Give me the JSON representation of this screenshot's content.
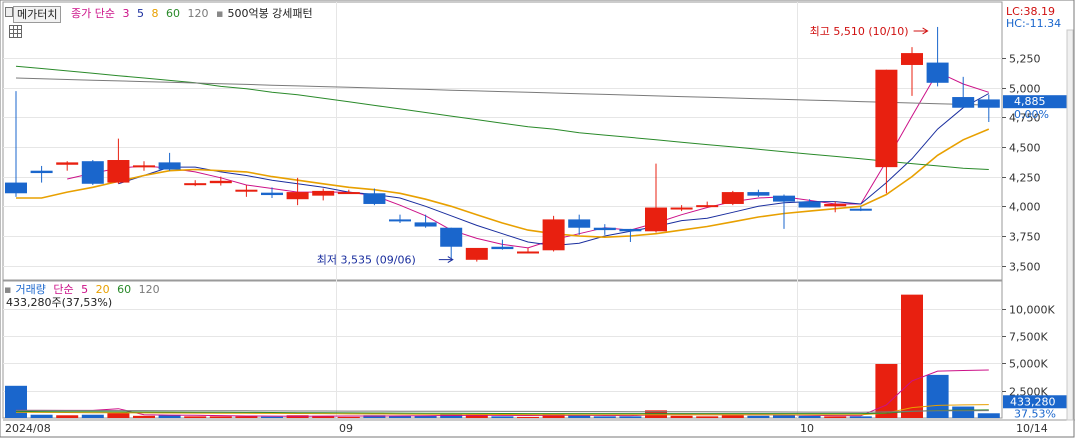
{
  "price_legend": {
    "tab_label": "메가터치",
    "ma_prefix": "종가 단순",
    "ma_periods": [
      "3",
      "5",
      "8",
      "60",
      "120"
    ],
    "ma_colors": [
      "#cc1188",
      "#1a2e9e",
      "#e8a000",
      "#2a8a2a",
      "#7a7a7a"
    ],
    "pattern_label": "500억봉 강세패턴"
  },
  "volume_legend": {
    "label": "거래량",
    "ma_prefix": "단순",
    "ma_periods": [
      "5",
      "20",
      "60",
      "120"
    ],
    "ma_colors": [
      "#cc1188",
      "#e8a000",
      "#2a8a2a",
      "#7a7a7a"
    ],
    "summary": "433,280주(37,53%)"
  },
  "right_panel": {
    "lc": "LC:38.19",
    "hc": "HC:-11.34",
    "current_price": "4,885",
    "current_change": "0.00%",
    "current_volume": "433,280",
    "current_volume_pct": "37.53%"
  },
  "annotations": {
    "high": "최고 5,510 (10/10)",
    "low": "최저 3,535 (09/06)"
  },
  "colors": {
    "up": "#e82010",
    "down": "#1a66cc",
    "grid": "#e6e6e6",
    "axis_text": "#333333",
    "price_box": "#1a66cc"
  },
  "chart_data": {
    "type": "candlestick",
    "price_axis": {
      "ylim": [
        3380,
        5720
      ],
      "ticks": [
        3500,
        3750,
        4000,
        4250,
        4500,
        4750,
        5000,
        5250
      ],
      "tick_labels": [
        "3,500",
        "3,750",
        "4,000",
        "4,250",
        "4,500",
        "4,750",
        "5,000",
        "5,250"
      ]
    },
    "volume_axis": {
      "ylim": [
        0,
        12000
      ],
      "ticks": [
        2500,
        5000,
        7500,
        10000
      ],
      "tick_labels": [
        "2,500K",
        "5,000K",
        "7,500K",
        "10,000K"
      ]
    },
    "x_labels": [
      {
        "index": 0,
        "label": "2024/08"
      },
      {
        "index": 13,
        "label": "09"
      },
      {
        "index": 31,
        "label": "10"
      },
      {
        "index": 39.5,
        "label": "10/14"
      }
    ],
    "candles": [
      {
        "o": 4200,
        "h": 4970,
        "l": 4080,
        "c": 4110,
        "v": 2950
      },
      {
        "o": 4300,
        "h": 4340,
        "l": 4200,
        "c": 4280,
        "v": 300
      },
      {
        "o": 4350,
        "h": 4380,
        "l": 4300,
        "c": 4370,
        "v": 250
      },
      {
        "o": 4380,
        "h": 4390,
        "l": 4180,
        "c": 4190,
        "v": 300
      },
      {
        "o": 4200,
        "h": 4570,
        "l": 4190,
        "c": 4390,
        "v": 450
      },
      {
        "o": 4330,
        "h": 4380,
        "l": 4300,
        "c": 4345,
        "v": 200
      },
      {
        "o": 4370,
        "h": 4450,
        "l": 4300,
        "c": 4310,
        "v": 250
      },
      {
        "o": 4185,
        "h": 4220,
        "l": 4170,
        "c": 4195,
        "v": 150
      },
      {
        "o": 4195,
        "h": 4250,
        "l": 4175,
        "c": 4215,
        "v": 150
      },
      {
        "o": 4140,
        "h": 4180,
        "l": 4080,
        "c": 4140,
        "v": 150
      },
      {
        "o": 4115,
        "h": 4160,
        "l": 4070,
        "c": 4095,
        "v": 120
      },
      {
        "o": 4060,
        "h": 4240,
        "l": 4010,
        "c": 4120,
        "v": 250
      },
      {
        "o": 4090,
        "h": 4150,
        "l": 4050,
        "c": 4130,
        "v": 200
      },
      {
        "o": 4120,
        "h": 4140,
        "l": 4110,
        "c": 4120,
        "v": 100
      },
      {
        "o": 4110,
        "h": 4150,
        "l": 4010,
        "c": 4020,
        "v": 250
      },
      {
        "o": 3890,
        "h": 3930,
        "l": 3860,
        "c": 3880,
        "v": 200
      },
      {
        "o": 3865,
        "h": 3930,
        "l": 3820,
        "c": 3830,
        "v": 200
      },
      {
        "o": 3820,
        "h": 3820,
        "l": 3560,
        "c": 3660,
        "v": 350
      },
      {
        "o": 3550,
        "h": 3600,
        "l": 3535,
        "c": 3650,
        "v": 300
      },
      {
        "o": 3660,
        "h": 3720,
        "l": 3635,
        "c": 3640,
        "v": 150
      },
      {
        "o": 3620,
        "h": 3650,
        "l": 3610,
        "c": 3620,
        "v": 100
      },
      {
        "o": 3630,
        "h": 3920,
        "l": 3620,
        "c": 3890,
        "v": 350
      },
      {
        "o": 3890,
        "h": 3930,
        "l": 3760,
        "c": 3820,
        "v": 300
      },
      {
        "o": 3820,
        "h": 3850,
        "l": 3760,
        "c": 3800,
        "v": 150
      },
      {
        "o": 3810,
        "h": 3810,
        "l": 3700,
        "c": 3790,
        "v": 150
      },
      {
        "o": 3790,
        "h": 4360,
        "l": 3780,
        "c": 3990,
        "v": 700
      },
      {
        "o": 3980,
        "h": 4010,
        "l": 3960,
        "c": 3990,
        "v": 200
      },
      {
        "o": 4000,
        "h": 4040,
        "l": 3990,
        "c": 4010,
        "v": 150
      },
      {
        "o": 4020,
        "h": 4130,
        "l": 4010,
        "c": 4120,
        "v": 250
      },
      {
        "o": 4120,
        "h": 4140,
        "l": 4080,
        "c": 4090,
        "v": 200
      },
      {
        "o": 4090,
        "h": 4100,
        "l": 3810,
        "c": 4040,
        "v": 250
      },
      {
        "o": 4040,
        "h": 4060,
        "l": 3990,
        "c": 3990,
        "v": 200
      },
      {
        "o": 4000,
        "h": 4040,
        "l": 3950,
        "c": 4020,
        "v": 150
      },
      {
        "o": 3980,
        "h": 4000,
        "l": 3960,
        "c": 3970,
        "v": 150
      },
      {
        "o": 4330,
        "h": 5150,
        "l": 4110,
        "c": 5150,
        "v": 4950
      },
      {
        "o": 5190,
        "h": 5340,
        "l": 4930,
        "c": 5290,
        "v": 11300
      },
      {
        "o": 5210,
        "h": 5510,
        "l": 5010,
        "c": 5040,
        "v": 3950
      },
      {
        "o": 4920,
        "h": 5090,
        "l": 4870,
        "c": 4830,
        "v": 1050
      },
      {
        "o": 4900,
        "h": 4940,
        "l": 4710,
        "c": 4830,
        "v": 433
      }
    ],
    "series": [
      {
        "name": "3",
        "color": "#cc1188",
        "panel": "price",
        "values": [
          null,
          null,
          4230,
          4280,
          4320,
          4340,
          4320,
          4290,
          4240,
          4180,
          4150,
          4120,
          4120,
          4120,
          4090,
          4010,
          3920,
          3800,
          3730,
          3680,
          3650,
          3720,
          3770,
          3820,
          3800,
          3860,
          3930,
          3990,
          4040,
          4070,
          4080,
          4050,
          4020,
          4020,
          4380,
          4760,
          5130,
          5030,
          4960
        ]
      },
      {
        "name": "5",
        "color": "#1a2e9e",
        "panel": "price",
        "values": [
          null,
          null,
          null,
          null,
          4190,
          4260,
          4330,
          4330,
          4290,
          4260,
          4220,
          4190,
          4160,
          4120,
          4100,
          4070,
          4000,
          3920,
          3840,
          3770,
          3700,
          3670,
          3690,
          3750,
          3790,
          3830,
          3880,
          3900,
          3950,
          4000,
          4030,
          4040,
          4040,
          4020,
          4200,
          4400,
          4650,
          4830,
          4950
        ]
      },
      {
        "name": "8",
        "color": "#e8a000",
        "panel": "price",
        "values": [
          4070,
          4070,
          4120,
          4160,
          4210,
          4260,
          4300,
          4310,
          4300,
          4290,
          4250,
          4220,
          4190,
          4160,
          4140,
          4110,
          4060,
          4000,
          3930,
          3860,
          3800,
          3770,
          3750,
          3740,
          3750,
          3770,
          3800,
          3830,
          3870,
          3910,
          3940,
          3960,
          3980,
          4000,
          4100,
          4250,
          4430,
          4560,
          4650
        ]
      },
      {
        "name": "60",
        "color": "#2a8a2a",
        "panel": "price",
        "values": [
          5180,
          5160,
          5140,
          5120,
          5100,
          5080,
          5060,
          5040,
          5010,
          4990,
          4960,
          4940,
          4910,
          4880,
          4850,
          4820,
          4790,
          4760,
          4730,
          4700,
          4670,
          4650,
          4620,
          4600,
          4580,
          4560,
          4540,
          4520,
          4500,
          4480,
          4460,
          4440,
          4420,
          4400,
          4380,
          4360,
          4340,
          4320,
          4310
        ]
      },
      {
        "name": "120",
        "color": "#7a7a7a",
        "panel": "price",
        "values": [
          5080,
          5074,
          5068,
          5062,
          5056,
          5050,
          5044,
          5038,
          5032,
          5026,
          5020,
          5014,
          5008,
          5002,
          4996,
          4990,
          4984,
          4978,
          4972,
          4966,
          4960,
          4954,
          4948,
          4942,
          4936,
          4930,
          4924,
          4918,
          4912,
          4906,
          4900,
          4894,
          4888,
          4882,
          4876,
          4870,
          4864,
          4858,
          4852
        ]
      },
      {
        "name": "5",
        "color": "#cc1188",
        "panel": "volume",
        "values": [
          700,
          700,
          700,
          700,
          850,
          300,
          270,
          250,
          220,
          180,
          170,
          160,
          170,
          180,
          180,
          190,
          200,
          230,
          260,
          240,
          230,
          240,
          250,
          230,
          220,
          300,
          310,
          300,
          300,
          300,
          280,
          260,
          220,
          200,
          1200,
          3400,
          4300,
          4350,
          4400
        ]
      },
      {
        "name": "20",
        "color": "#e8a000",
        "panel": "volume",
        "values": [
          520,
          510,
          500,
          490,
          480,
          470,
          460,
          450,
          440,
          430,
          420,
          410,
          400,
          380,
          370,
          360,
          350,
          340,
          330,
          320,
          310,
          300,
          290,
          290,
          290,
          290,
          290,
          290,
          290,
          290,
          290,
          290,
          290,
          290,
          450,
          950,
          1150,
          1200,
          1230
        ]
      },
      {
        "name": "60",
        "color": "#2a8a2a",
        "panel": "volume",
        "values": [
          600,
          590,
          580,
          570,
          560,
          550,
          540,
          530,
          520,
          510,
          500,
          490,
          480,
          470,
          460,
          450,
          440,
          430,
          420,
          410,
          400,
          400,
          400,
          400,
          400,
          400,
          400,
          400,
          400,
          400,
          400,
          400,
          400,
          400,
          450,
          600,
          700,
          720,
          740
        ]
      },
      {
        "name": "120",
        "color": "#7a7a7a",
        "panel": "volume",
        "values": [
          700,
          695,
          690,
          685,
          680,
          675,
          670,
          665,
          660,
          655,
          650,
          645,
          640,
          635,
          630,
          625,
          620,
          615,
          610,
          605,
          600,
          595,
          590,
          585,
          580,
          575,
          570,
          565,
          560,
          555,
          550,
          545,
          540,
          535,
          560,
          620,
          660,
          670,
          680
        ]
      }
    ]
  }
}
